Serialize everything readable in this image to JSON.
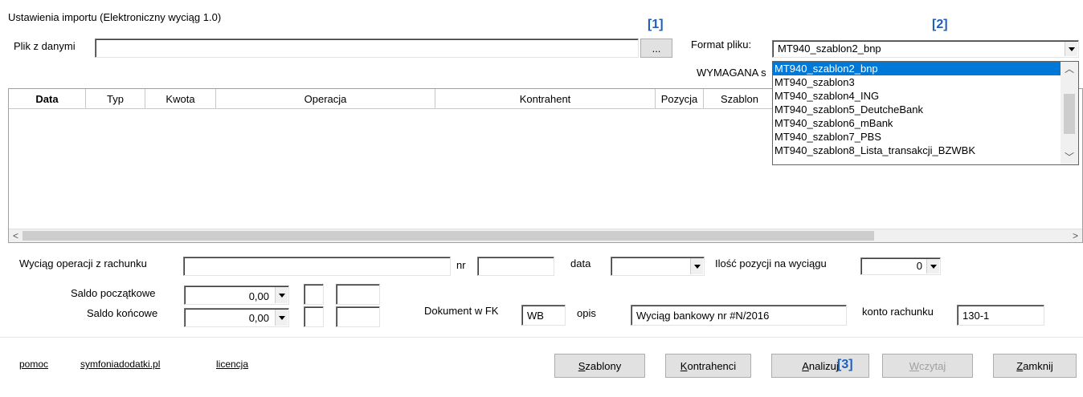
{
  "window": {
    "title": "Ustawienia importu (Elektroniczny wyciąg 1.0)"
  },
  "annotations": {
    "a1": "[1]",
    "a2": "[2]",
    "a3": "[3]"
  },
  "file": {
    "label": "Plik z danymi",
    "value": "",
    "browse_label": "..."
  },
  "format": {
    "label": "Format pliku:",
    "selected": "MT940_szablon2_bnp",
    "required_label": "WYMAGANA s",
    "options": [
      "MT940_szablon2_bnp",
      "MT940_szablon3",
      "MT940_szablon4_ING",
      "MT940_szablon5_DeutcheBank",
      "MT940_szablon6_mBank",
      "MT940_szablon7_PBS",
      "MT940_szablon8_Lista_transakcji_BZWBK"
    ]
  },
  "grid": {
    "columns": [
      "Data",
      "Typ",
      "Kwota",
      "Operacja",
      "Kontrahent",
      "Pozycja",
      "Szablon"
    ],
    "rows": [],
    "scroll_left": "<",
    "scroll_right": ">"
  },
  "statement": {
    "account_ops_label": "Wyciąg operacji z rachunku",
    "account_ops_value": "",
    "nr_label": "nr",
    "nr_value": "",
    "date_label": "data",
    "date_value": "",
    "count_label": "Ilość pozycji na wyciągu",
    "count_value": "0"
  },
  "balance": {
    "opening_label": "Saldo początkowe",
    "opening_value": "0,00",
    "closing_label": "Saldo końcowe",
    "closing_value": "0,00"
  },
  "document": {
    "doc_label": "Dokument w FK",
    "doc_value": "WB",
    "desc_label": "opis",
    "desc_value": "Wyciąg bankowy nr #N/2016",
    "account_label": "konto rachunku",
    "account_value": "130-1"
  },
  "links": {
    "help": "pomoc",
    "site": "symfoniadodatki.pl",
    "license": "licencja"
  },
  "buttons": {
    "templates": {
      "mn": "S",
      "rest": "zablony"
    },
    "contractors": {
      "mn": "K",
      "rest": "ontrahenci"
    },
    "analyze": {
      "mn": "A",
      "rest": "nalizuj"
    },
    "load": {
      "mn": "W",
      "rest": "czytaj"
    },
    "close": {
      "mn": "Z",
      "rest": "amknij"
    }
  }
}
